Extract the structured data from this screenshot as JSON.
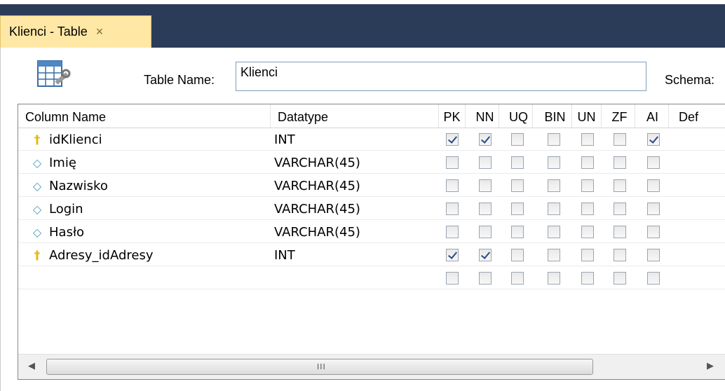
{
  "tab": {
    "label": "Klienci - Table",
    "close": "×"
  },
  "form": {
    "table_name_label": "Table Name:",
    "table_name_value": "Klienci",
    "schema_label": "Schema:"
  },
  "columns": {
    "name": "Column Name",
    "datatype": "Datatype",
    "flags": [
      "PK",
      "NN",
      "UQ",
      "BIN",
      "UN",
      "ZF",
      "AI",
      "Def"
    ]
  },
  "rows": [
    {
      "name": "idKlienci",
      "type": "INT",
      "icon": "key-icon",
      "flags": [
        true,
        true,
        false,
        false,
        false,
        false,
        true
      ]
    },
    {
      "name": "Imię",
      "type": "VARCHAR(45)",
      "icon": "diamond-icon",
      "flags": [
        false,
        false,
        false,
        false,
        false,
        false,
        false
      ]
    },
    {
      "name": "Nazwisko",
      "type": "VARCHAR(45)",
      "icon": "diamond-icon",
      "flags": [
        false,
        false,
        false,
        false,
        false,
        false,
        false
      ]
    },
    {
      "name": "Login",
      "type": "VARCHAR(45)",
      "icon": "diamond-icon",
      "flags": [
        false,
        false,
        false,
        false,
        false,
        false,
        false
      ]
    },
    {
      "name": "Hasło",
      "type": "VARCHAR(45)",
      "icon": "diamond-icon",
      "flags": [
        false,
        false,
        false,
        false,
        false,
        false,
        false
      ]
    },
    {
      "name": "Adresy_idAdresy",
      "type": "INT",
      "icon": "key-icon",
      "flags": [
        true,
        true,
        false,
        false,
        false,
        false,
        false
      ]
    },
    {
      "name": "",
      "type": "",
      "icon": "",
      "flags": [
        false,
        false,
        false,
        false,
        false,
        false,
        false
      ]
    }
  ],
  "scrollbar": {
    "left": "◀",
    "right": "▶",
    "grip": "III"
  }
}
